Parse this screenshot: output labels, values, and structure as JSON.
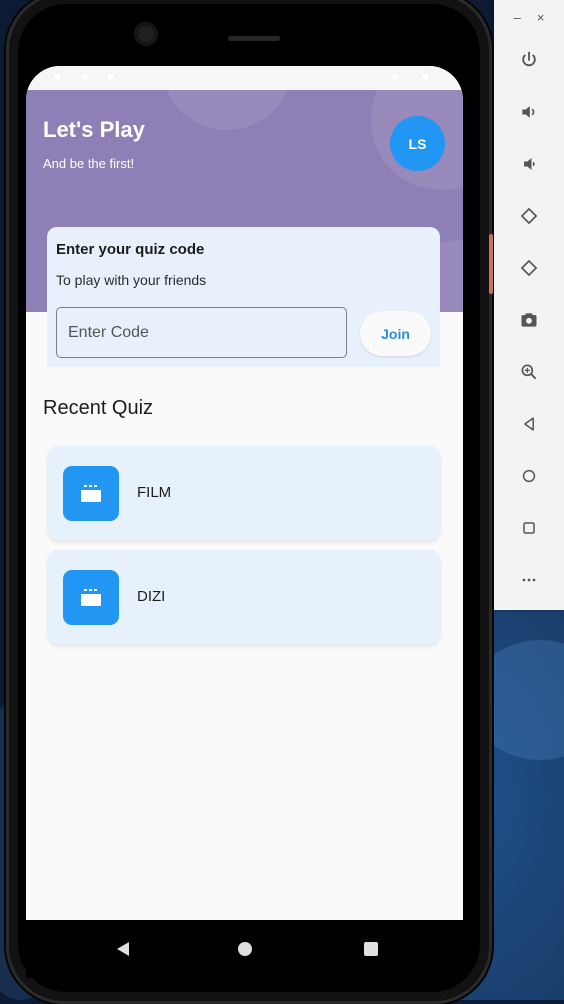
{
  "toolbar": {
    "minimize_label": "–",
    "close_label": "×",
    "buttons": [
      "power-icon",
      "volume-up-icon",
      "volume-down-icon",
      "rotate-left-icon",
      "rotate-right-icon",
      "camera-icon",
      "zoom-icon",
      "back-icon",
      "home-icon",
      "overview-icon",
      "more-icon"
    ]
  },
  "header": {
    "title": "Let's Play",
    "subtitle": "And be the first!",
    "avatar_initials": "LS",
    "background_color": "#8e80b6",
    "avatar_color": "#2196f3"
  },
  "code_card": {
    "title": "Enter your quiz code",
    "subtitle": "To play with your friends",
    "input_placeholder": "Enter Code",
    "join_label": "Join"
  },
  "recent": {
    "section_title": "Recent Quiz",
    "items": [
      {
        "label": "FILM",
        "icon": "movie-clapper-icon"
      },
      {
        "label": "DIZI",
        "icon": "movie-clapper-icon"
      }
    ]
  },
  "navbar": {
    "buttons": [
      "back-icon",
      "home-icon",
      "recents-icon"
    ]
  },
  "colors": {
    "accent": "#2196f3",
    "card_bg": "#e6f1fc"
  }
}
